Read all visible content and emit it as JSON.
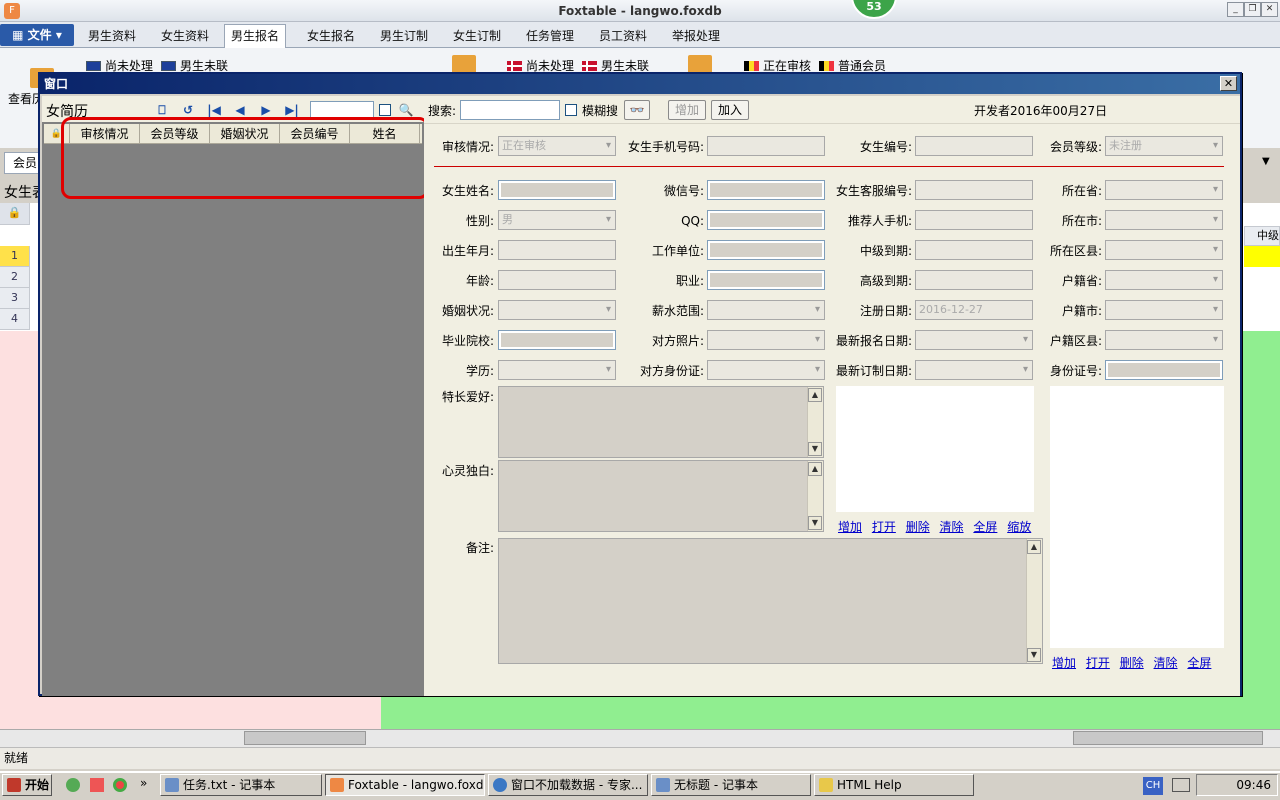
{
  "app": {
    "title": "Foxtable - langwo.foxdb",
    "badge": "53",
    "icon": "foxtable-app-icon"
  },
  "menu": {
    "file_label": "▦ 文件 ▾",
    "tabs": [
      "男生资料",
      "女生资料",
      "男生报名",
      "女生报名",
      "男生订制",
      "女生订制",
      "任务管理",
      "员工资料",
      "举报处理"
    ],
    "active_tab": "男生报名"
  },
  "ribbon": {
    "left_cut": "查看历",
    "items": [
      "尚未处理",
      "男生未联",
      "尚未处理",
      "男生未联",
      "正在审核",
      "普通会员"
    ]
  },
  "background": {
    "tab_label": "会员",
    "table_label": "女生表",
    "row_numbers": [
      "1",
      "2",
      "3",
      "4"
    ],
    "col_cut": "中级"
  },
  "status": {
    "text": "就绪"
  },
  "taskbar": {
    "start": "开始",
    "items": [
      "任务.txt - 记事本",
      "Foxtable - langwo.foxdb",
      "窗口不加载数据 - 专家...",
      "无标题 - 记事本",
      "HTML Help"
    ],
    "lang": "CH",
    "time": "09:46"
  },
  "window": {
    "title": "窗口",
    "close": "✕",
    "left": {
      "title": "女简历",
      "nav_icons": [
        "⎕",
        "↺",
        "|◀",
        "◀",
        "▶",
        "▶|",
        "🔍"
      ],
      "columns": [
        "审核情况",
        "会员等级",
        "婚姻状况",
        "会员编号",
        "姓名"
      ]
    },
    "toolbar": {
      "search_label": "搜索:",
      "fuzzy_label": "模糊搜",
      "add_label": "增加",
      "join_label": "加入",
      "developer": "开发者2016年00月27日"
    },
    "form": {
      "row0": [
        {
          "label": "审核情况:",
          "value": "正在审核"
        },
        {
          "label": "女生手机号码:",
          "value": ""
        },
        {
          "label": "女生编号:",
          "value": ""
        },
        {
          "label": "会员等级:",
          "value": "未注册"
        }
      ],
      "grid": [
        [
          {
            "label": "女生姓名:",
            "value": ""
          },
          {
            "label": "微信号:",
            "value": ""
          },
          {
            "label": "女生客服编号:",
            "value": ""
          },
          {
            "label": "所在省:",
            "value": ""
          }
        ],
        [
          {
            "label": "性别:",
            "value": "男"
          },
          {
            "label": "QQ:",
            "value": ""
          },
          {
            "label": "推荐人手机:",
            "value": ""
          },
          {
            "label": "所在市:",
            "value": ""
          }
        ],
        [
          {
            "label": "出生年月:",
            "value": ""
          },
          {
            "label": "工作单位:",
            "value": ""
          },
          {
            "label": "中级到期:",
            "value": ""
          },
          {
            "label": "所在区县:",
            "value": ""
          }
        ],
        [
          {
            "label": "年龄:",
            "value": ""
          },
          {
            "label": "职业:",
            "value": ""
          },
          {
            "label": "高级到期:",
            "value": ""
          },
          {
            "label": "户籍省:",
            "value": ""
          }
        ],
        [
          {
            "label": "婚姻状况:",
            "value": ""
          },
          {
            "label": "薪水范围:",
            "value": ""
          },
          {
            "label": "注册日期:",
            "value": "2016-12-27"
          },
          {
            "label": "户籍市:",
            "value": ""
          }
        ],
        [
          {
            "label": "毕业院校:",
            "value": ""
          },
          {
            "label": "对方照片:",
            "value": ""
          },
          {
            "label": "最新报名日期:",
            "value": ""
          },
          {
            "label": "户籍区县:",
            "value": ""
          }
        ],
        [
          {
            "label": "学历:",
            "value": ""
          },
          {
            "label": "对方身份证:",
            "value": ""
          },
          {
            "label": "最新订制日期:",
            "value": ""
          },
          {
            "label": "身份证号:",
            "value": ""
          }
        ]
      ],
      "hobby_label": "特长爱好:",
      "monologue_label": "心灵独白:",
      "remark_label": "备注:",
      "photo_links": [
        "增加",
        "打开",
        "删除",
        "清除",
        "全屏",
        "缩放"
      ],
      "id_links": [
        "增加",
        "打开",
        "删除",
        "清除",
        "全屏"
      ]
    }
  }
}
